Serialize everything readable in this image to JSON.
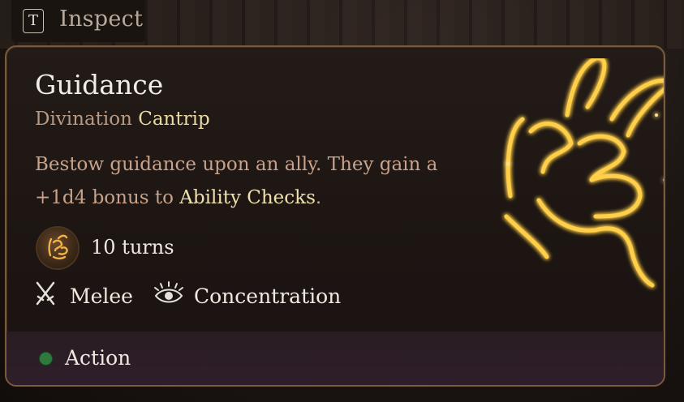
{
  "inspect": {
    "key": "T",
    "label": "Inspect"
  },
  "spell": {
    "name": "Guidance",
    "school": "Divination",
    "level": "Cantrip",
    "description_prefix": "Bestow guidance upon an ally. They gain a +1d4 bonus to",
    "description_highlight": "Ability Checks",
    "description_suffix": ".",
    "duration": "10 turns",
    "tags": [
      "Melee",
      "Concentration"
    ],
    "cost": "Action"
  },
  "colors": {
    "accent_gold": "#efe0ad",
    "border": "#7d5a3a",
    "action_dot": "#2d7a3c",
    "glow": "#ffcf4a"
  },
  "icons": {
    "key": "t-key-icon",
    "duration": "guidance-hand-icon",
    "melee": "crossed-swords-icon",
    "concentration": "concentration-eye-icon",
    "art": "glowing-hand-icon"
  }
}
